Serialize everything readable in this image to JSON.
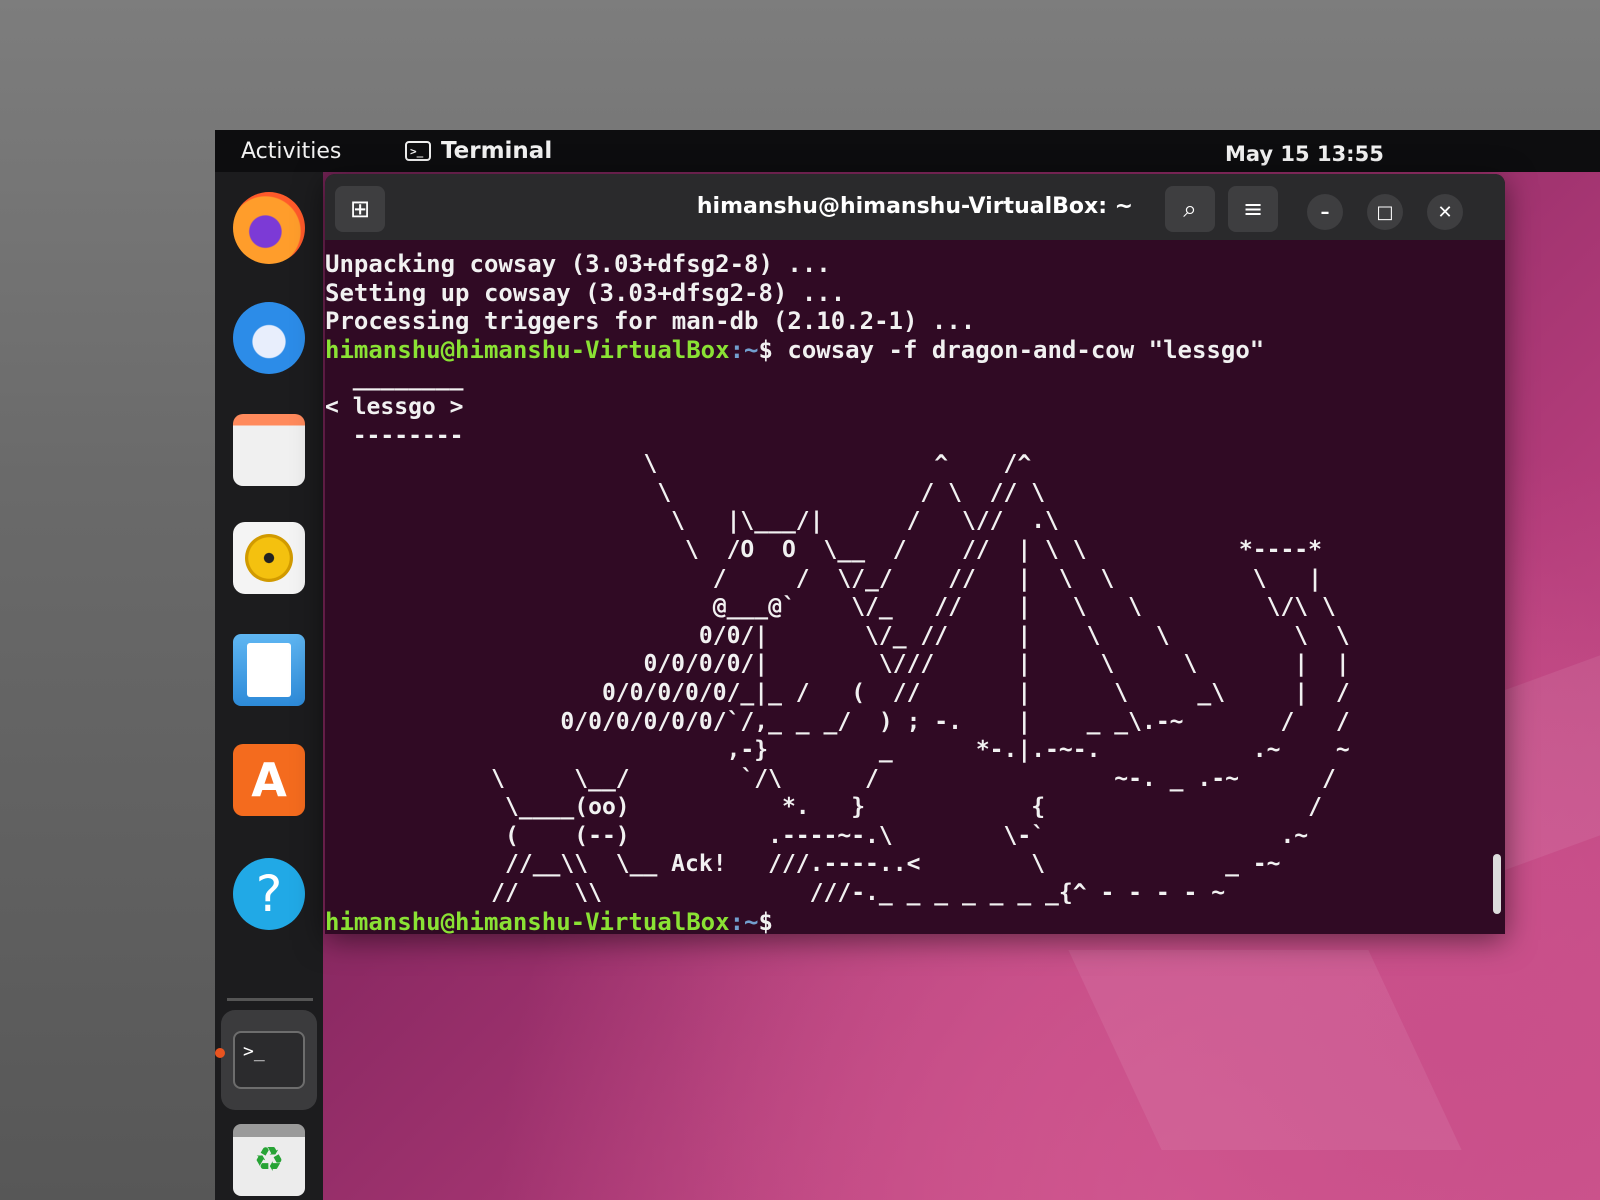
{
  "topbar": {
    "activities": "Activities",
    "app_name": "Terminal",
    "clock": "May 15  13:55"
  },
  "dock": {
    "items": [
      "firefox-icon",
      "thunderbird-icon",
      "files-icon",
      "rhythmbox-icon",
      "libreoffice-writer-icon",
      "software-icon",
      "help-icon",
      "terminal-icon",
      "trash-icon"
    ]
  },
  "terminal": {
    "title": "himanshu@himanshu-VirtualBox: ~",
    "lines": [
      "Unpacking cowsay (3.03+dfsg2-8) ...",
      "Setting up cowsay (3.03+dfsg2-8) ...",
      "Processing triggers for man-db (2.10.2-1) ..."
    ],
    "prompt_user": "himanshu@himanshu-VirtualBox",
    "prompt_path": ":~",
    "prompt_symbol": "$",
    "command": " cowsay -f dragon-and-cow \"lessgo\"",
    "art": "  ________\n< lessgo >\n  --------\n                       \\                    ^    /^\n                        \\                  / \\  // \\\n                         \\   |\\___/|      /   \\//  .\\\n                          \\  /O  O  \\__  /    //  | \\ \\           *----*\n                            /     /  \\/_/    //   |  \\  \\          \\   |\n                            @___@`    \\/_   //    |   \\   \\         \\/\\ \\\n                           0/0/|       \\/_ //     |    \\    \\         \\  \\\n                       0/0/0/0/|        \\///      |     \\     \\       |  |\n                    0/0/0/0/0/_|_ /   (  //       |      \\     _\\     |  /\n                 0/0/0/0/0/0/`/,_ _ _/  ) ; -.    |    _ _\\.-~       /   /\n                             ,-}        _      *-.|.-~-.           .~    ~\n            \\     \\__/        `/\\      /                 ~-. _ .-~      /\n             \\____(oo)           *.   }            {                   /\n             (    (--)          .----~-.\\        \\-`                 .~\n             //__\\\\  \\__ Ack!   ///.----..<        \\             _ -~\n            //    \\\\               ///-._ _ _ _ _ _ _{^ - - - - ~",
    "final_prompt_user": "himanshu@himanshu-VirtualBox",
    "final_prompt_path": ":~",
    "final_prompt_symbol": "$"
  }
}
